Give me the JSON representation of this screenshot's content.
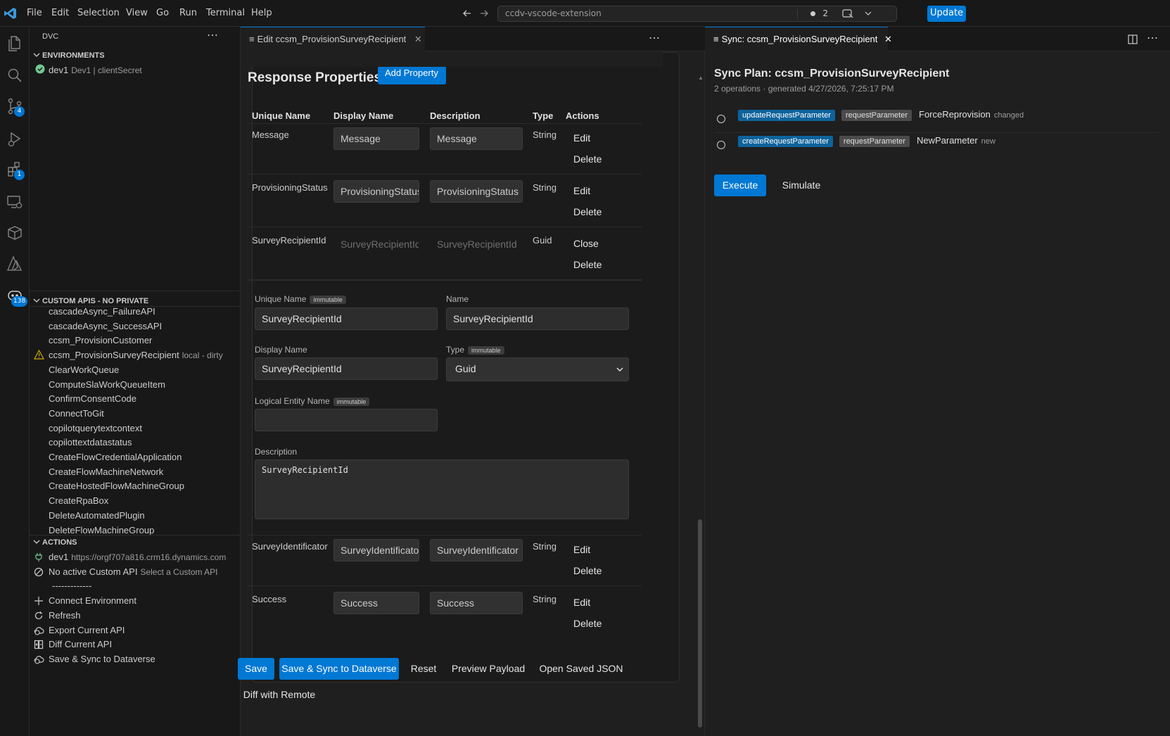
{
  "titlebar": {
    "menu": [
      "File",
      "Edit",
      "Selection",
      "View",
      "Go",
      "Run",
      "Terminal",
      "Help"
    ],
    "search_text": "ccdv-vscode-extension",
    "notifications_count": "2",
    "update_label": "Update"
  },
  "activitybar": {
    "icons": [
      "files-icon",
      "search-icon",
      "source-control-icon",
      "run-debug-icon",
      "extensions-icon",
      "remote-explorer-icon",
      "package-icon",
      "azure-icon",
      "dvc-icon"
    ],
    "source_control_badge": "4",
    "extensions_badge": "1",
    "dvc_badge": "138"
  },
  "sidebar": {
    "title": "DVC",
    "environments_header": "ENVIRONMENTS",
    "environment": {
      "name": "dev1",
      "desc": "Dev1 | clientSecret"
    },
    "custom_apis_header": "CUSTOM APIS - NO PRIVATE",
    "custom_apis": [
      {
        "name": "cascadeAsync_FailureAPI"
      },
      {
        "name": "cascadeAsync_SuccessAPI"
      },
      {
        "name": "ccsm_ProvisionCustomer"
      },
      {
        "name": "ccsm_ProvisionSurveyRecipient",
        "desc": "local - dirty",
        "warning": true
      },
      {
        "name": "ClearWorkQueue"
      },
      {
        "name": "ComputeSlaWorkQueueItem"
      },
      {
        "name": "ConfirmConsentCode"
      },
      {
        "name": "ConnectToGit"
      },
      {
        "name": "copilotquerytextcontext"
      },
      {
        "name": "copilottextdatastatus"
      },
      {
        "name": "CreateFlowCredentialApplication"
      },
      {
        "name": "CreateFlowMachineNetwork"
      },
      {
        "name": "CreateHostedFlowMachineGroup"
      },
      {
        "name": "CreateRpaBox"
      },
      {
        "name": "DeleteAutomatedPlugin"
      },
      {
        "name": "DeleteFlowMachineGroup"
      }
    ],
    "actions_header": "ACTIONS",
    "actions": [
      {
        "name": "dev1",
        "desc": "https://orgf707a816.crm16.dynamics.com",
        "icon": "plug-icon"
      },
      {
        "name": "No active Custom API",
        "desc": "Select a Custom API",
        "icon": "circle-slash-icon"
      },
      {
        "name": "-------------",
        "icon": ""
      },
      {
        "name": "Connect Environment",
        "icon": "plus-icon"
      },
      {
        "name": "Refresh",
        "icon": "refresh-icon"
      },
      {
        "name": "Export Current API",
        "icon": "cloud-sync-icon"
      },
      {
        "name": "Diff Current API",
        "icon": "diff-icon"
      },
      {
        "name": "Save & Sync to Dataverse",
        "icon": "cloud-sync-icon"
      }
    ]
  },
  "editor": {
    "tab_label": "Edit ccsm_ProvisionSurveyRecipient",
    "section_title": "Response Properties",
    "add_property_label": "Add Property",
    "columns": [
      "Unique Name",
      "Display Name",
      "Description",
      "Type",
      "Actions"
    ],
    "rows_top": [
      {
        "unique": "Message",
        "display": "Message",
        "description": "Message",
        "type": "String",
        "action1": "Edit",
        "action2": "Delete",
        "ghost": false
      },
      {
        "unique": "ProvisioningStatus",
        "display": "ProvisioningStatus",
        "description": "ProvisioningStatus",
        "type": "String",
        "action1": "Edit",
        "action2": "Delete",
        "ghost": false
      },
      {
        "unique": "SurveyRecipientId",
        "display": "SurveyRecipientId",
        "description": "SurveyRecipientId",
        "type": "Guid",
        "action1": "Close",
        "action2": "Delete",
        "ghost": true
      }
    ],
    "edit_form": {
      "immutable_tag": "immutable",
      "unique_name_label": "Unique Name",
      "unique_name_value": "SurveyRecipientId",
      "name_label": "Name",
      "name_value": "SurveyRecipientId",
      "display_name_label": "Display Name",
      "display_name_value": "SurveyRecipientId",
      "type_label": "Type",
      "type_value": "Guid",
      "logical_entity_label": "Logical Entity Name",
      "logical_entity_value": "",
      "description_label": "Description",
      "description_value": "SurveyRecipientId"
    },
    "rows_bottom": [
      {
        "unique": "SurveyIdentificator",
        "display": "SurveyIdentificator",
        "description": "SurveyIdentificator",
        "type": "String",
        "action1": "Edit",
        "action2": "Delete"
      },
      {
        "unique": "Success",
        "display": "Success",
        "description": "Success",
        "type": "String",
        "action1": "Edit",
        "action2": "Delete"
      }
    ],
    "buttons": {
      "save": "Save",
      "save_sync": "Save & Sync to Dataverse",
      "reset": "Reset",
      "preview": "Preview Payload",
      "open_json": "Open Saved JSON",
      "diff_remote": "Diff with Remote"
    }
  },
  "sync": {
    "tab_label": "Sync: ccsm_ProvisionSurveyRecipient",
    "title": "Sync Plan: ccsm_ProvisionSurveyRecipient",
    "subtitle": "2 operations · generated 4/27/2026, 7:25:17 PM",
    "operations": [
      {
        "op": "updateRequestParameter",
        "kind": "requestParameter",
        "name": "ForceReprovision",
        "state": "changed"
      },
      {
        "op": "createRequestParameter",
        "kind": "requestParameter",
        "name": "NewParameter",
        "state": "new"
      }
    ],
    "execute_label": "Execute",
    "simulate_label": "Simulate"
  },
  "colors": {
    "accent": "#0078d4",
    "warning": "#cca700",
    "success": "#73c991"
  }
}
